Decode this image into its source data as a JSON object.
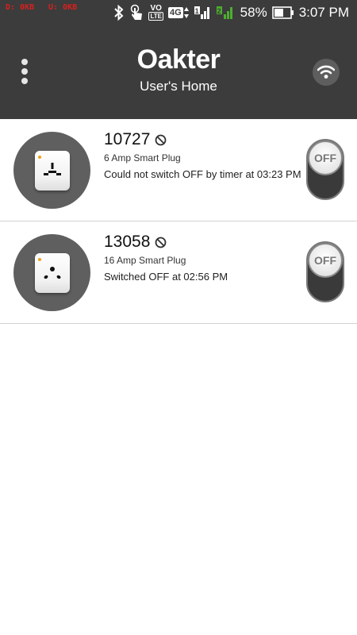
{
  "status_bar": {
    "download": "D: 0KB",
    "upload": "U: 0KB",
    "volte_top": "VO",
    "volte_bottom": "LTE",
    "network_type": "4G",
    "sim1": "1",
    "sim2": "2",
    "battery": "58%",
    "time": "3:07 PM"
  },
  "header": {
    "brand": "Oakter",
    "subtitle": "User's Home"
  },
  "devices": [
    {
      "id": "10727",
      "type": "6 Amp Smart Plug",
      "status": "Could not switch OFF by timer at 03:23 PM",
      "toggle_label": "OFF"
    },
    {
      "id": "13058",
      "type": "16 Amp Smart Plug",
      "status": "Switched OFF at 02:56 PM",
      "toggle_label": "OFF"
    }
  ]
}
